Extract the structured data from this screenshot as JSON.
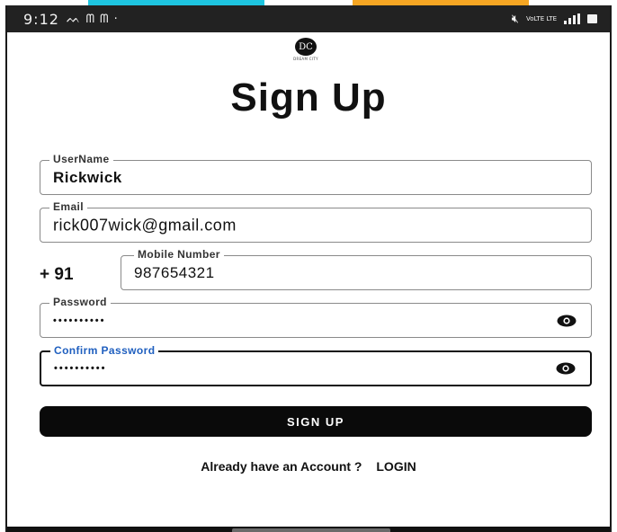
{
  "status_bar": {
    "time": "9:12",
    "notifications": "ᨓ ᗰ ᗰ ·",
    "network": "VoLTE LTE"
  },
  "logo": {
    "monogram": "DC",
    "text": "DREAM CITY"
  },
  "title": "Sign Up",
  "fields": {
    "username": {
      "label": "UserName",
      "value": "Rickwick"
    },
    "email": {
      "label": "Email",
      "value": "rick007wick@gmail.com"
    },
    "country_code": "+ 91",
    "mobile": {
      "label": "Mobile Number",
      "value": "987654321"
    },
    "password": {
      "label": "Password",
      "value": "••••••••••"
    },
    "confirm_password": {
      "label": "Confirm Password",
      "value": "••••••••••"
    }
  },
  "signup_button": "SIGN UP",
  "footer": {
    "prompt": "Already have an Account ?",
    "login": "LOGIN"
  },
  "colors": {
    "accent_label": "#1f5fbf",
    "button_bg": "#0a0a0a",
    "status_bar": "#222222"
  },
  "icons": [
    "eye-icon",
    "mute-icon",
    "signal-icon",
    "battery-icon"
  ]
}
